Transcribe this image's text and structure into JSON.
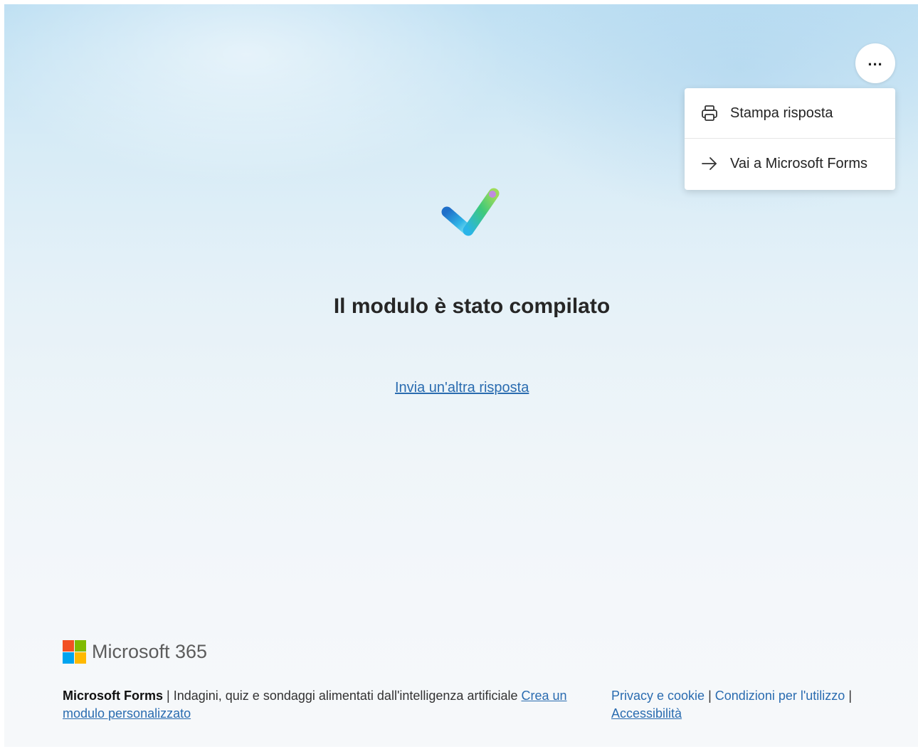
{
  "menu": {
    "more_label": "...",
    "items": [
      {
        "label": "Stampa risposta",
        "icon": "printer-icon"
      },
      {
        "label": "Vai a Microsoft Forms",
        "icon": "arrow-right-icon"
      }
    ]
  },
  "main": {
    "title": "Il modulo è stato compilato",
    "another_response": "Invia un'altra risposta"
  },
  "branding": {
    "wordmark": "Microsoft 365",
    "logo_colors": [
      "#f25022",
      "#7fba00",
      "#00a4ef",
      "#ffb900"
    ]
  },
  "footer": {
    "brand": "Microsoft Forms",
    "separator": "|",
    "tagline": "Indagini, quiz e sondaggi alimentati dall'intelligenza artificiale",
    "create_link_part1": "Crea un",
    "create_link_part2": "modulo personalizzato",
    "privacy": "Privacy e cookie",
    "terms": "Condizioni per l'utilizzo",
    "accessibility": "Accessibilità"
  },
  "colors": {
    "link": "#2a6cb0",
    "title": "#262626"
  }
}
